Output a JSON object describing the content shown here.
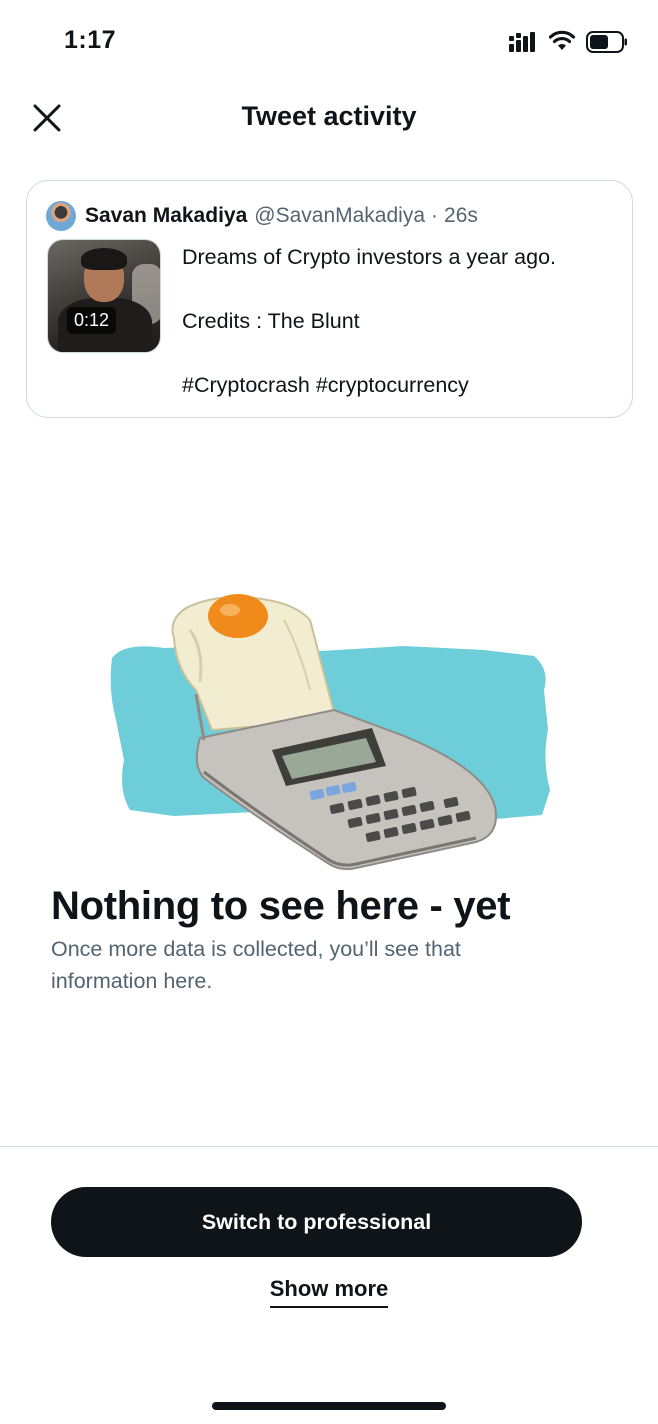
{
  "status_bar": {
    "time": "1:17",
    "icons": [
      "signal-icon",
      "wifi-icon",
      "battery-icon"
    ]
  },
  "header": {
    "close_icon": "close-icon",
    "title": "Tweet activity"
  },
  "tweet": {
    "author_name": "Savan Makadiya",
    "author_handle": "@SavanMakadiya",
    "separator": "·",
    "timestamp": "26s",
    "video_duration": "0:12",
    "text_lines": [
      "Dreams of Crypto investors a year ago.",
      "Credits : The Blunt",
      "#Cryptocrash #cryptocurrency"
    ]
  },
  "empty_state": {
    "illustration_icon": "calculator-egg-illustration",
    "title": "Nothing to see here - yet",
    "description": "Once more data is collected, you’ll see that information here."
  },
  "actions": {
    "primary_label": "Switch to professional",
    "secondary_label": "Show more"
  },
  "colors": {
    "text_primary": "#0f1419",
    "text_secondary": "#536471",
    "border": "#cfd9de",
    "button_bg": "#0f1419",
    "illustration_accent": "#6dcdd9"
  }
}
